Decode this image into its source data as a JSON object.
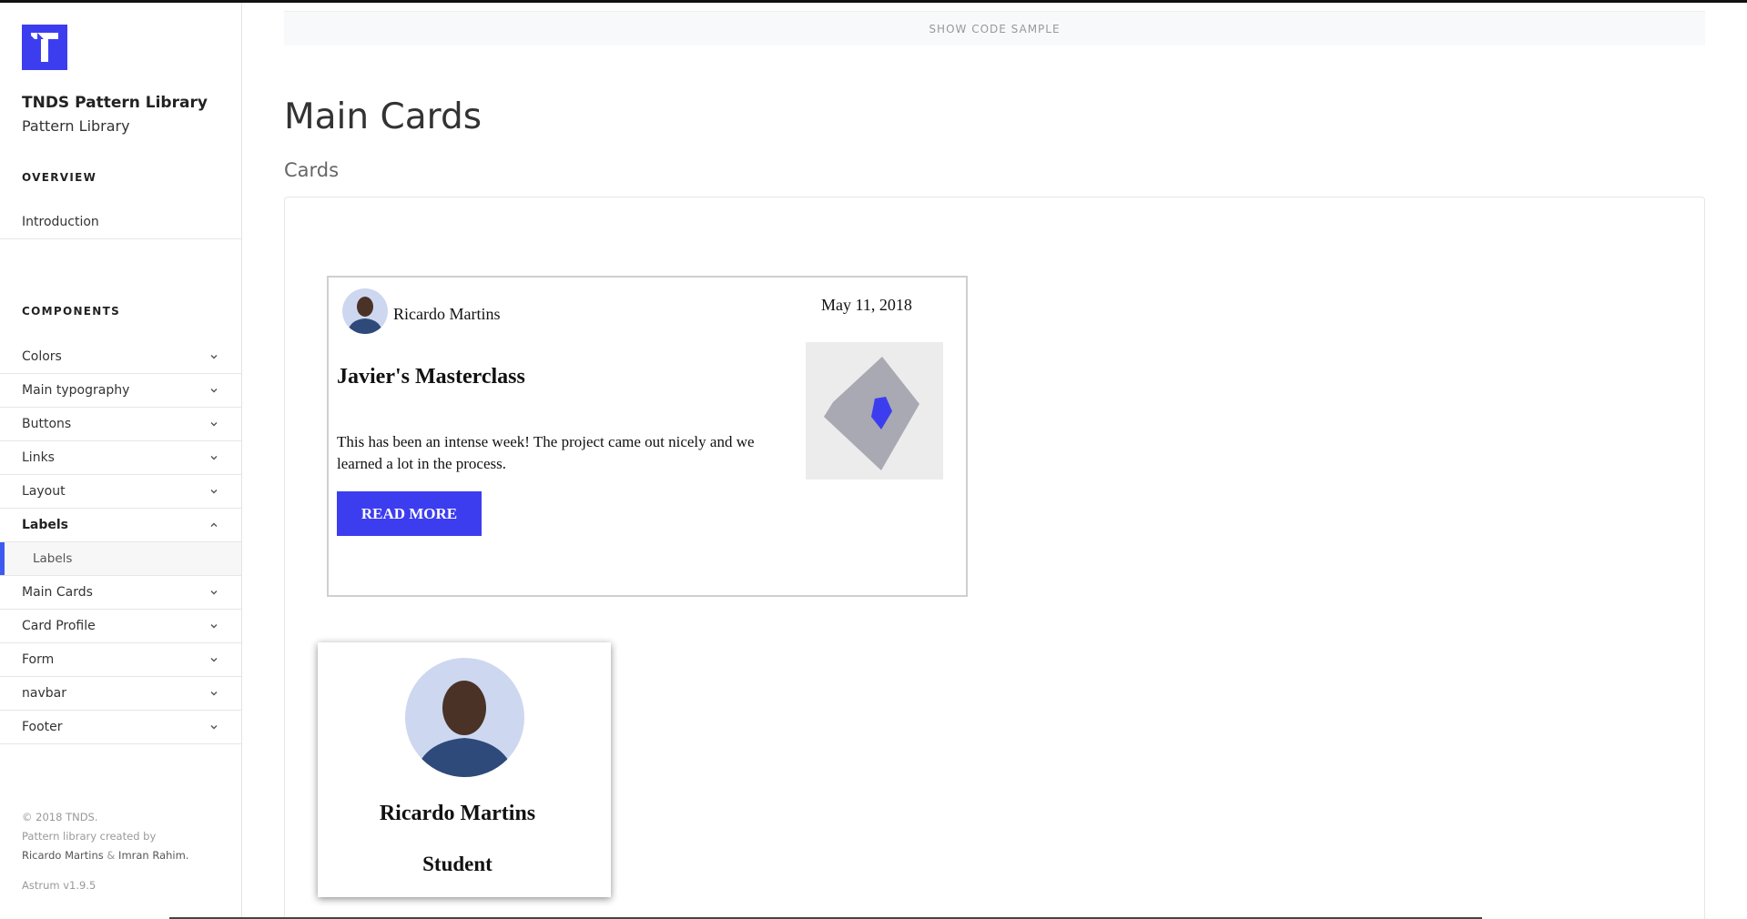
{
  "brand": {
    "title": "TNDS Pattern Library",
    "subtitle": "Pattern Library",
    "logo_color": "#3d3df0"
  },
  "sidebar": {
    "overview_heading": "OVERVIEW",
    "intro_label": "Introduction",
    "components_heading": "COMPONENTS",
    "items": [
      {
        "label": "Colors",
        "icon": "chevron-down-icon"
      },
      {
        "label": "Main typography",
        "icon": "chevron-down-icon"
      },
      {
        "label": "Buttons",
        "icon": "chevron-down-icon"
      },
      {
        "label": "Links",
        "icon": "chevron-down-icon"
      },
      {
        "label": "Layout",
        "icon": "chevron-down-icon"
      },
      {
        "label": "Labels",
        "icon": "chevron-up-icon",
        "expanded": true
      },
      {
        "label": "Labels",
        "sub": true,
        "active": true
      },
      {
        "label": "Main Cards",
        "icon": "chevron-down-icon"
      },
      {
        "label": "Card Profile",
        "icon": "chevron-down-icon"
      },
      {
        "label": "Form",
        "icon": "chevron-down-icon"
      },
      {
        "label": "navbar",
        "icon": "chevron-down-icon"
      },
      {
        "label": "Footer",
        "icon": "chevron-down-icon"
      }
    ],
    "active_color": "#3d5bf0",
    "footer": {
      "copyright": "© 2018 TNDS.",
      "created_by": "Pattern library created by",
      "author_1": "Ricardo Martins",
      "amp": "&",
      "author_2": "Imran Rahim.",
      "version": "Astrum v1.9.5"
    }
  },
  "main": {
    "show_code_label": "SHOW CODE SAMPLE",
    "title": "Main Cards",
    "subtitle": "Cards",
    "main_card": {
      "author": "Ricardo Martins",
      "date": "May 11, 2018",
      "title": "Javier's Masterclass",
      "body": "This has been an intense week! The project came out nicely and we learned a lot in the process.",
      "button_label": "READ MORE",
      "button_color": "#3d3df0"
    },
    "profile_card": {
      "name": "Ricardo Martins",
      "role": "Student"
    }
  }
}
